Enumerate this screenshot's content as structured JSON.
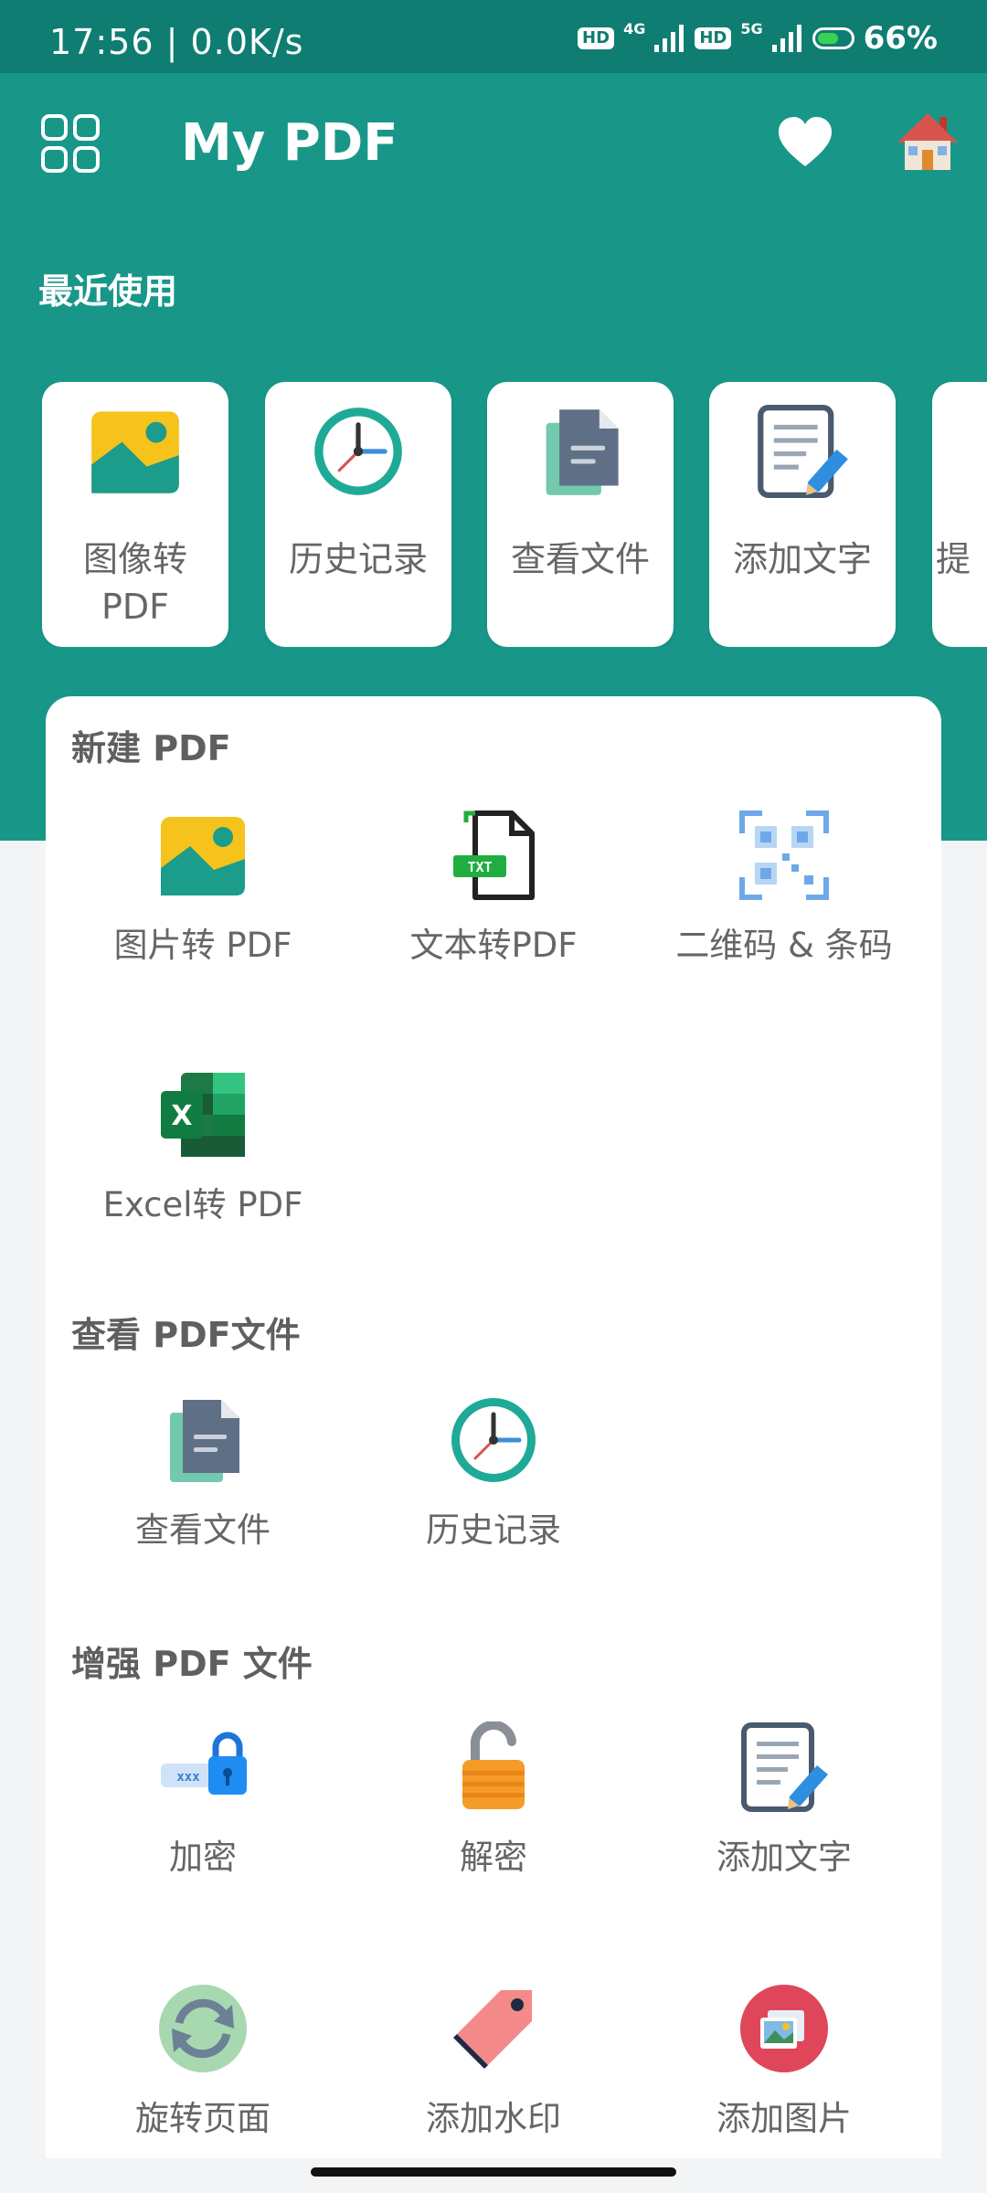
{
  "status": {
    "time": "17:56 | 0.0K/s",
    "hd1": "HD",
    "net1": "4G",
    "hd2": "HD",
    "net2": "5G",
    "battery": "66%",
    "battery_level": 0.66
  },
  "header": {
    "title": "My PDF",
    "menu_icon": "grid-icon",
    "favorite_icon": "heart-icon",
    "home_icon": "home-icon"
  },
  "recent": {
    "title": "最近使用",
    "items": [
      {
        "label": "图像转PDF",
        "icon": "image-icon"
      },
      {
        "label": "历史记录",
        "icon": "clock-icon"
      },
      {
        "label": "查看文件",
        "icon": "document-icon"
      },
      {
        "label": "添加文字",
        "icon": "edit-document-icon"
      },
      {
        "label": "提",
        "icon": "document-icon"
      }
    ]
  },
  "sections": {
    "new_pdf": {
      "title": "新建 PDF",
      "items": [
        {
          "label": "图片转 PDF",
          "icon": "image-icon"
        },
        {
          "label": "文本转PDF",
          "icon": "txt-file-icon"
        },
        {
          "label": "二维码 & 条码",
          "icon": "qr-code-icon"
        },
        {
          "label": "Excel转 PDF",
          "icon": "excel-icon"
        }
      ]
    },
    "view_pdf": {
      "title": "查看 PDF文件",
      "items": [
        {
          "label": "查看文件",
          "icon": "document-icon"
        },
        {
          "label": "历史记录",
          "icon": "clock-icon"
        }
      ]
    },
    "enhance_pdf": {
      "title": "增强 PDF 文件",
      "items": [
        {
          "label": "加密",
          "icon": "lock-icon"
        },
        {
          "label": "解密",
          "icon": "unlock-icon"
        },
        {
          "label": "添加文字",
          "icon": "edit-document-icon"
        },
        {
          "label": "旋转页面",
          "icon": "rotate-icon"
        },
        {
          "label": "添加水印",
          "icon": "tag-icon"
        },
        {
          "label": "添加图片",
          "icon": "add-image-icon"
        }
      ]
    }
  },
  "colors": {
    "header_bg": "#189789",
    "status_bg": "#0f7d72",
    "page_bg": "#f3f4f6",
    "card_bg": "#ffffff",
    "label_text": "#666666"
  }
}
